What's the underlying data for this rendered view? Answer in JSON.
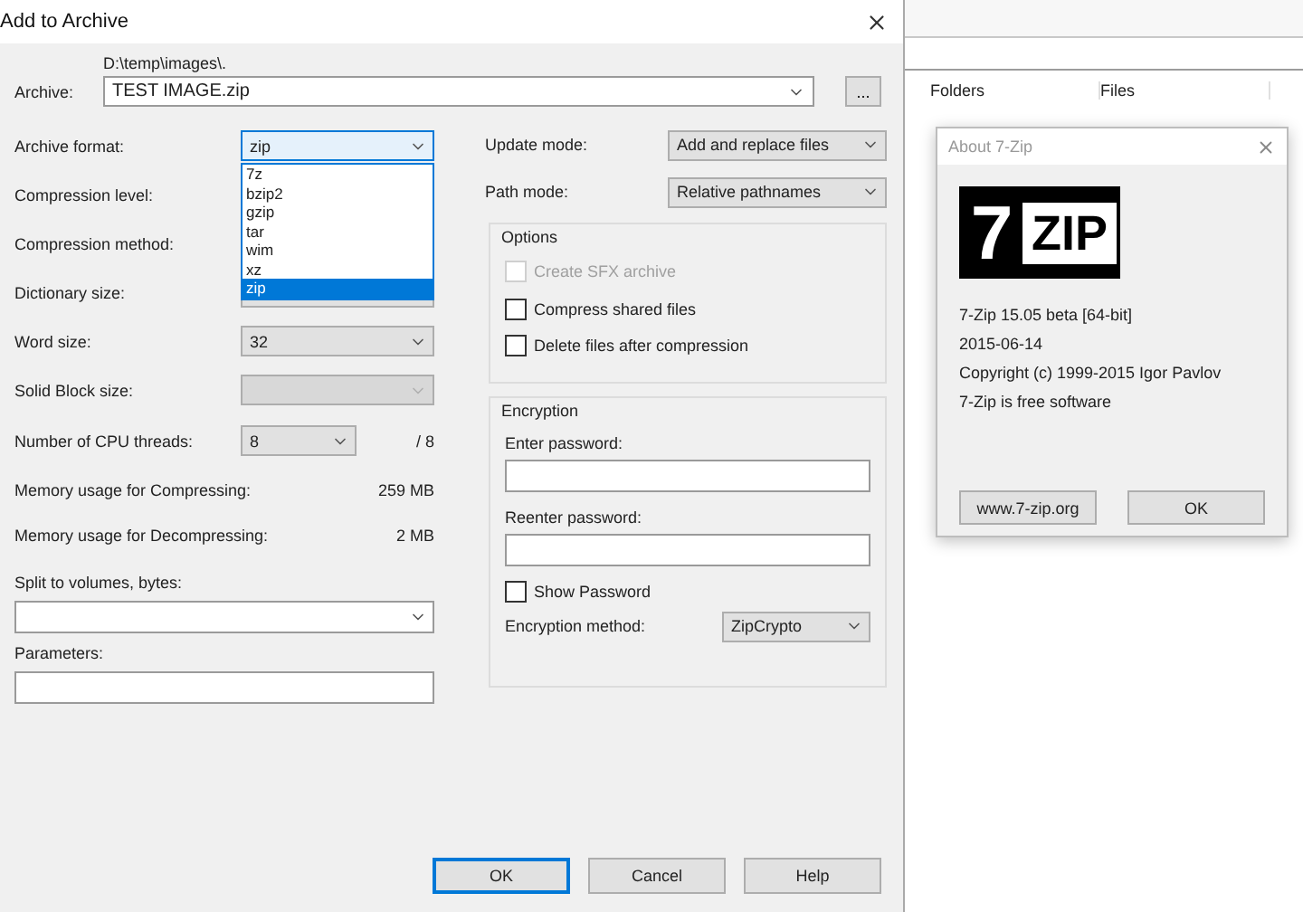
{
  "add_dialog": {
    "title": "Add to Archive",
    "archive": {
      "label": "Archive:",
      "path": "D:\\temp\\images\\.",
      "value": "TEST IMAGE.zip",
      "browse": "..."
    },
    "left_rows": [
      {
        "kind": "combo",
        "label": "Archive format:",
        "value": "zip",
        "disabled": false
      },
      {
        "kind": "label",
        "label": "Compression level:"
      },
      {
        "kind": "label",
        "label": "Compression method:"
      },
      {
        "kind": "covered_combo",
        "label": "Dictionary size:"
      },
      {
        "kind": "combo",
        "label": "Word size:",
        "value": "32",
        "disabled": false
      },
      {
        "kind": "combo",
        "label": "Solid Block size:",
        "disabled": true
      },
      {
        "kind": "combo",
        "label": "Number of CPU threads:",
        "value": "8",
        "suffix": "/ 8",
        "disabled": false
      },
      {
        "kind": "info",
        "label": "Memory usage for Compressing:",
        "value": "259 MB"
      },
      {
        "kind": "info",
        "label": "Memory usage for Decompressing:",
        "value": "2 MB"
      }
    ],
    "format_list": [
      {
        "label": "7z",
        "selected": false
      },
      {
        "label": "bzip2",
        "selected": false
      },
      {
        "label": "gzip",
        "selected": false
      },
      {
        "label": "tar",
        "selected": false
      },
      {
        "label": "wim",
        "selected": false
      },
      {
        "label": "xz",
        "selected": false
      },
      {
        "label": "zip",
        "selected": true
      }
    ],
    "split": {
      "label": "Split to volumes, bytes:"
    },
    "parameters": {
      "label": "Parameters:"
    },
    "update_mode": {
      "label": "Update mode:",
      "value": "Add and replace files"
    },
    "path_mode": {
      "label": "Path mode:",
      "value": "Relative pathnames"
    },
    "options": {
      "title": "Options",
      "items": [
        {
          "label": "Create SFX archive",
          "checked": false,
          "disabled": true
        },
        {
          "label": "Compress shared files",
          "checked": false,
          "disabled": false
        },
        {
          "label": "Delete files after compression",
          "checked": false,
          "disabled": false
        }
      ]
    },
    "encryption": {
      "title": "Encryption",
      "password_label": "Enter password:",
      "reenter_label": "Reenter password:",
      "show_password": {
        "label": "Show Password",
        "checked": false
      },
      "method_label": "Encryption method:",
      "method_value": "ZipCrypto"
    },
    "buttons": [
      {
        "label": "OK",
        "default": true
      },
      {
        "label": "Cancel",
        "default": false
      },
      {
        "label": "Help",
        "default": false
      }
    ]
  },
  "file_manager": {
    "columns": [
      "Folders",
      "Files"
    ]
  },
  "about_dialog": {
    "title": "About 7-Zip",
    "logo": {
      "number": "7",
      "word": "ZIP"
    },
    "lines": [
      "7-Zip 15.05 beta [64-bit]",
      "2015-06-14",
      "Copyright (c) 1999-2015 Igor Pavlov",
      "7-Zip is free software"
    ],
    "buttons": [
      "www.7-zip.org",
      "OK"
    ]
  }
}
